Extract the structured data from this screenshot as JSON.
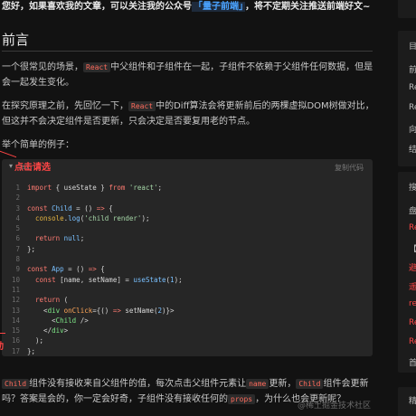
{
  "notice": {
    "before": "您好，如果喜欢我的文章，可以关注我的公众号",
    "highlight": "「量子前端」",
    "after": "，将不定期关注推送前端好文~"
  },
  "heading": "前言",
  "para1": {
    "a": "一个很常见的场景，",
    "code": "React",
    "b": "中父组件和子组件在一起，子组件不依赖于父组件任何数据，但是会一起发生变化。"
  },
  "para2": {
    "a": "在探究原理之前，先回忆一下，",
    "code": "React",
    "b": "中的Diff算法会将更新前后的两棵虚拟DOM树做对比，但这并不会决定组件是否更新，只会决定是否要复用老的节点。"
  },
  "para3": "举个简单的例子：",
  "annotations": {
    "top": "点击请选",
    "left": "动"
  },
  "code": {
    "lang": "jsx",
    "copy": "复制代码"
  },
  "para4": {
    "c1": "Child",
    "t1": "组件没有接收来自父组件的值，每次点击父组件元素让",
    "c2": "name",
    "t2": "更新，",
    "c3": "Child",
    "t3": "组件会更新吗？答案是会的，你一定会好奇，子组件没有接收任何的",
    "c4": "props",
    "t4": "，为什么也会更新呢？"
  },
  "watermark": "@稀土掘金技术社区",
  "sidebar": {
    "card1": [
      "目",
      "前",
      "Re",
      "Re",
      "向",
      "结"
    ],
    "card2": [
      "搜",
      "盘",
      "Re",
      "【",
      "避",
      "遥",
      "re",
      "Re",
      "Re",
      "首"
    ],
    "card3": [
      "精"
    ]
  }
}
